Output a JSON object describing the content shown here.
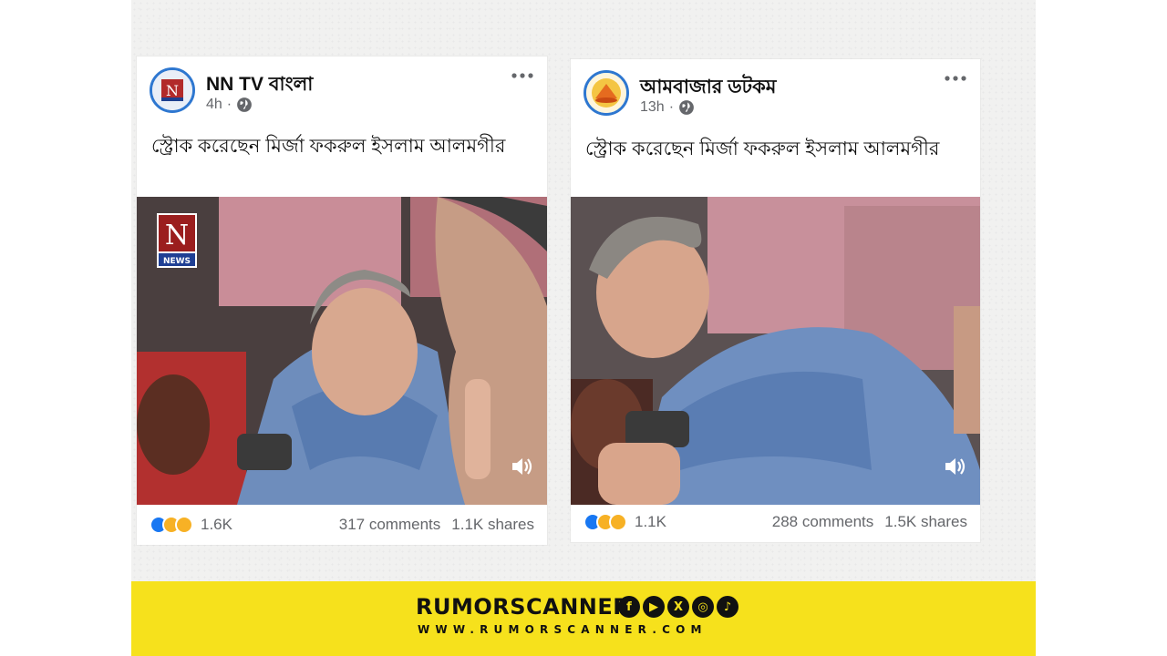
{
  "posts": [
    {
      "page_name": "NN TV বাংলা",
      "time": "4h",
      "caption": "স্ট্রোক করেছেন মির্জা ফকরুল ইসলাম আলমগীর",
      "watermark": "NEWS",
      "reactions_count": "1.6K",
      "comments": "317 comments",
      "shares": "1.1K shares"
    },
    {
      "page_name": "আমবাজার ডটকম",
      "time": "13h",
      "caption": "স্ট্রোক করেছেন মির্জা ফকরুল ইসলাম আলমগীর",
      "reactions_count": "1.1K",
      "comments": "288 comments",
      "shares": "1.5K shares"
    }
  ],
  "reaction_icons": [
    "like-icon",
    "sad-icon",
    "haha-icon"
  ],
  "banner": {
    "brand": "RUMORSCANNER",
    "website": "WWW.RUMORSCANNER.COM",
    "socials": [
      "facebook-icon",
      "youtube-icon",
      "x-icon",
      "instagram-icon",
      "tiktok-icon"
    ]
  },
  "colors": {
    "banner": "#f6e11c",
    "avatar_ring": "#2e77d0",
    "like": "#1877f2",
    "meta_text": "#65676b"
  }
}
